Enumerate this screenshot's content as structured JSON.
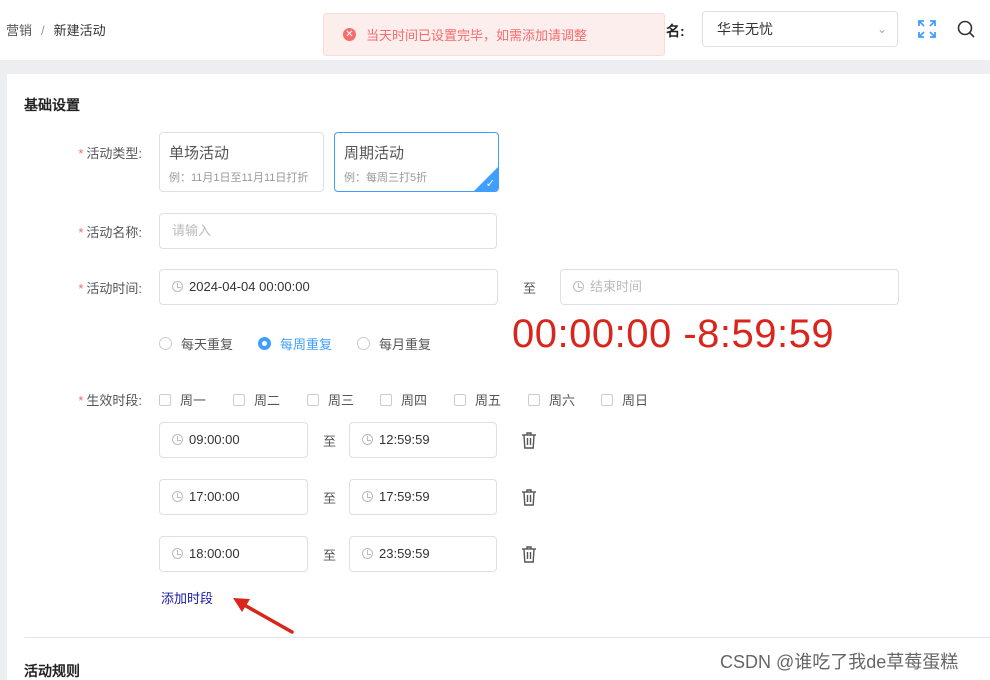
{
  "breadcrumb": {
    "parent": "营销",
    "separator": "/",
    "current": "新建活动"
  },
  "toast": {
    "message": "当天时间已设置完毕，如需添加请调整"
  },
  "header": {
    "shop_label": "名:",
    "shop_value": "华丰无忧"
  },
  "basic": {
    "title": "基础设置",
    "type_label": "活动类型:",
    "types": [
      {
        "title": "单场活动",
        "desc": "例：11月1日至11月11日打折",
        "selected": false
      },
      {
        "title": "周期活动",
        "desc": "例：每周三打5折",
        "selected": true
      }
    ],
    "name_label": "活动名称:",
    "name_placeholder": "请输入",
    "time_label": "活动时间:",
    "start_time": "2024-04-04 00:00:00",
    "to": "至",
    "end_placeholder": "结束时间",
    "repeat_options": [
      {
        "label": "每天重复",
        "selected": false
      },
      {
        "label": "每周重复",
        "selected": true
      },
      {
        "label": "每月重复",
        "selected": false
      }
    ],
    "annotation": "00:00:00 -8:59:59",
    "period_label": "生效时段:",
    "weekdays": [
      "周一",
      "周二",
      "周三",
      "周四",
      "周五",
      "周六",
      "周日"
    ],
    "periods": [
      {
        "start": "09:00:00",
        "end": "12:59:59"
      },
      {
        "start": "17:00:00",
        "end": "17:59:59"
      },
      {
        "start": "18:00:00",
        "end": "23:59:59"
      }
    ],
    "add_period": "添加时段"
  },
  "rules": {
    "title": "活动规则"
  },
  "watermark": "CSDN @谁吃了我de草莓蛋糕",
  "colors": {
    "primary": "#409eff",
    "error": "#f56c6c",
    "annotation": "#d9251c"
  }
}
